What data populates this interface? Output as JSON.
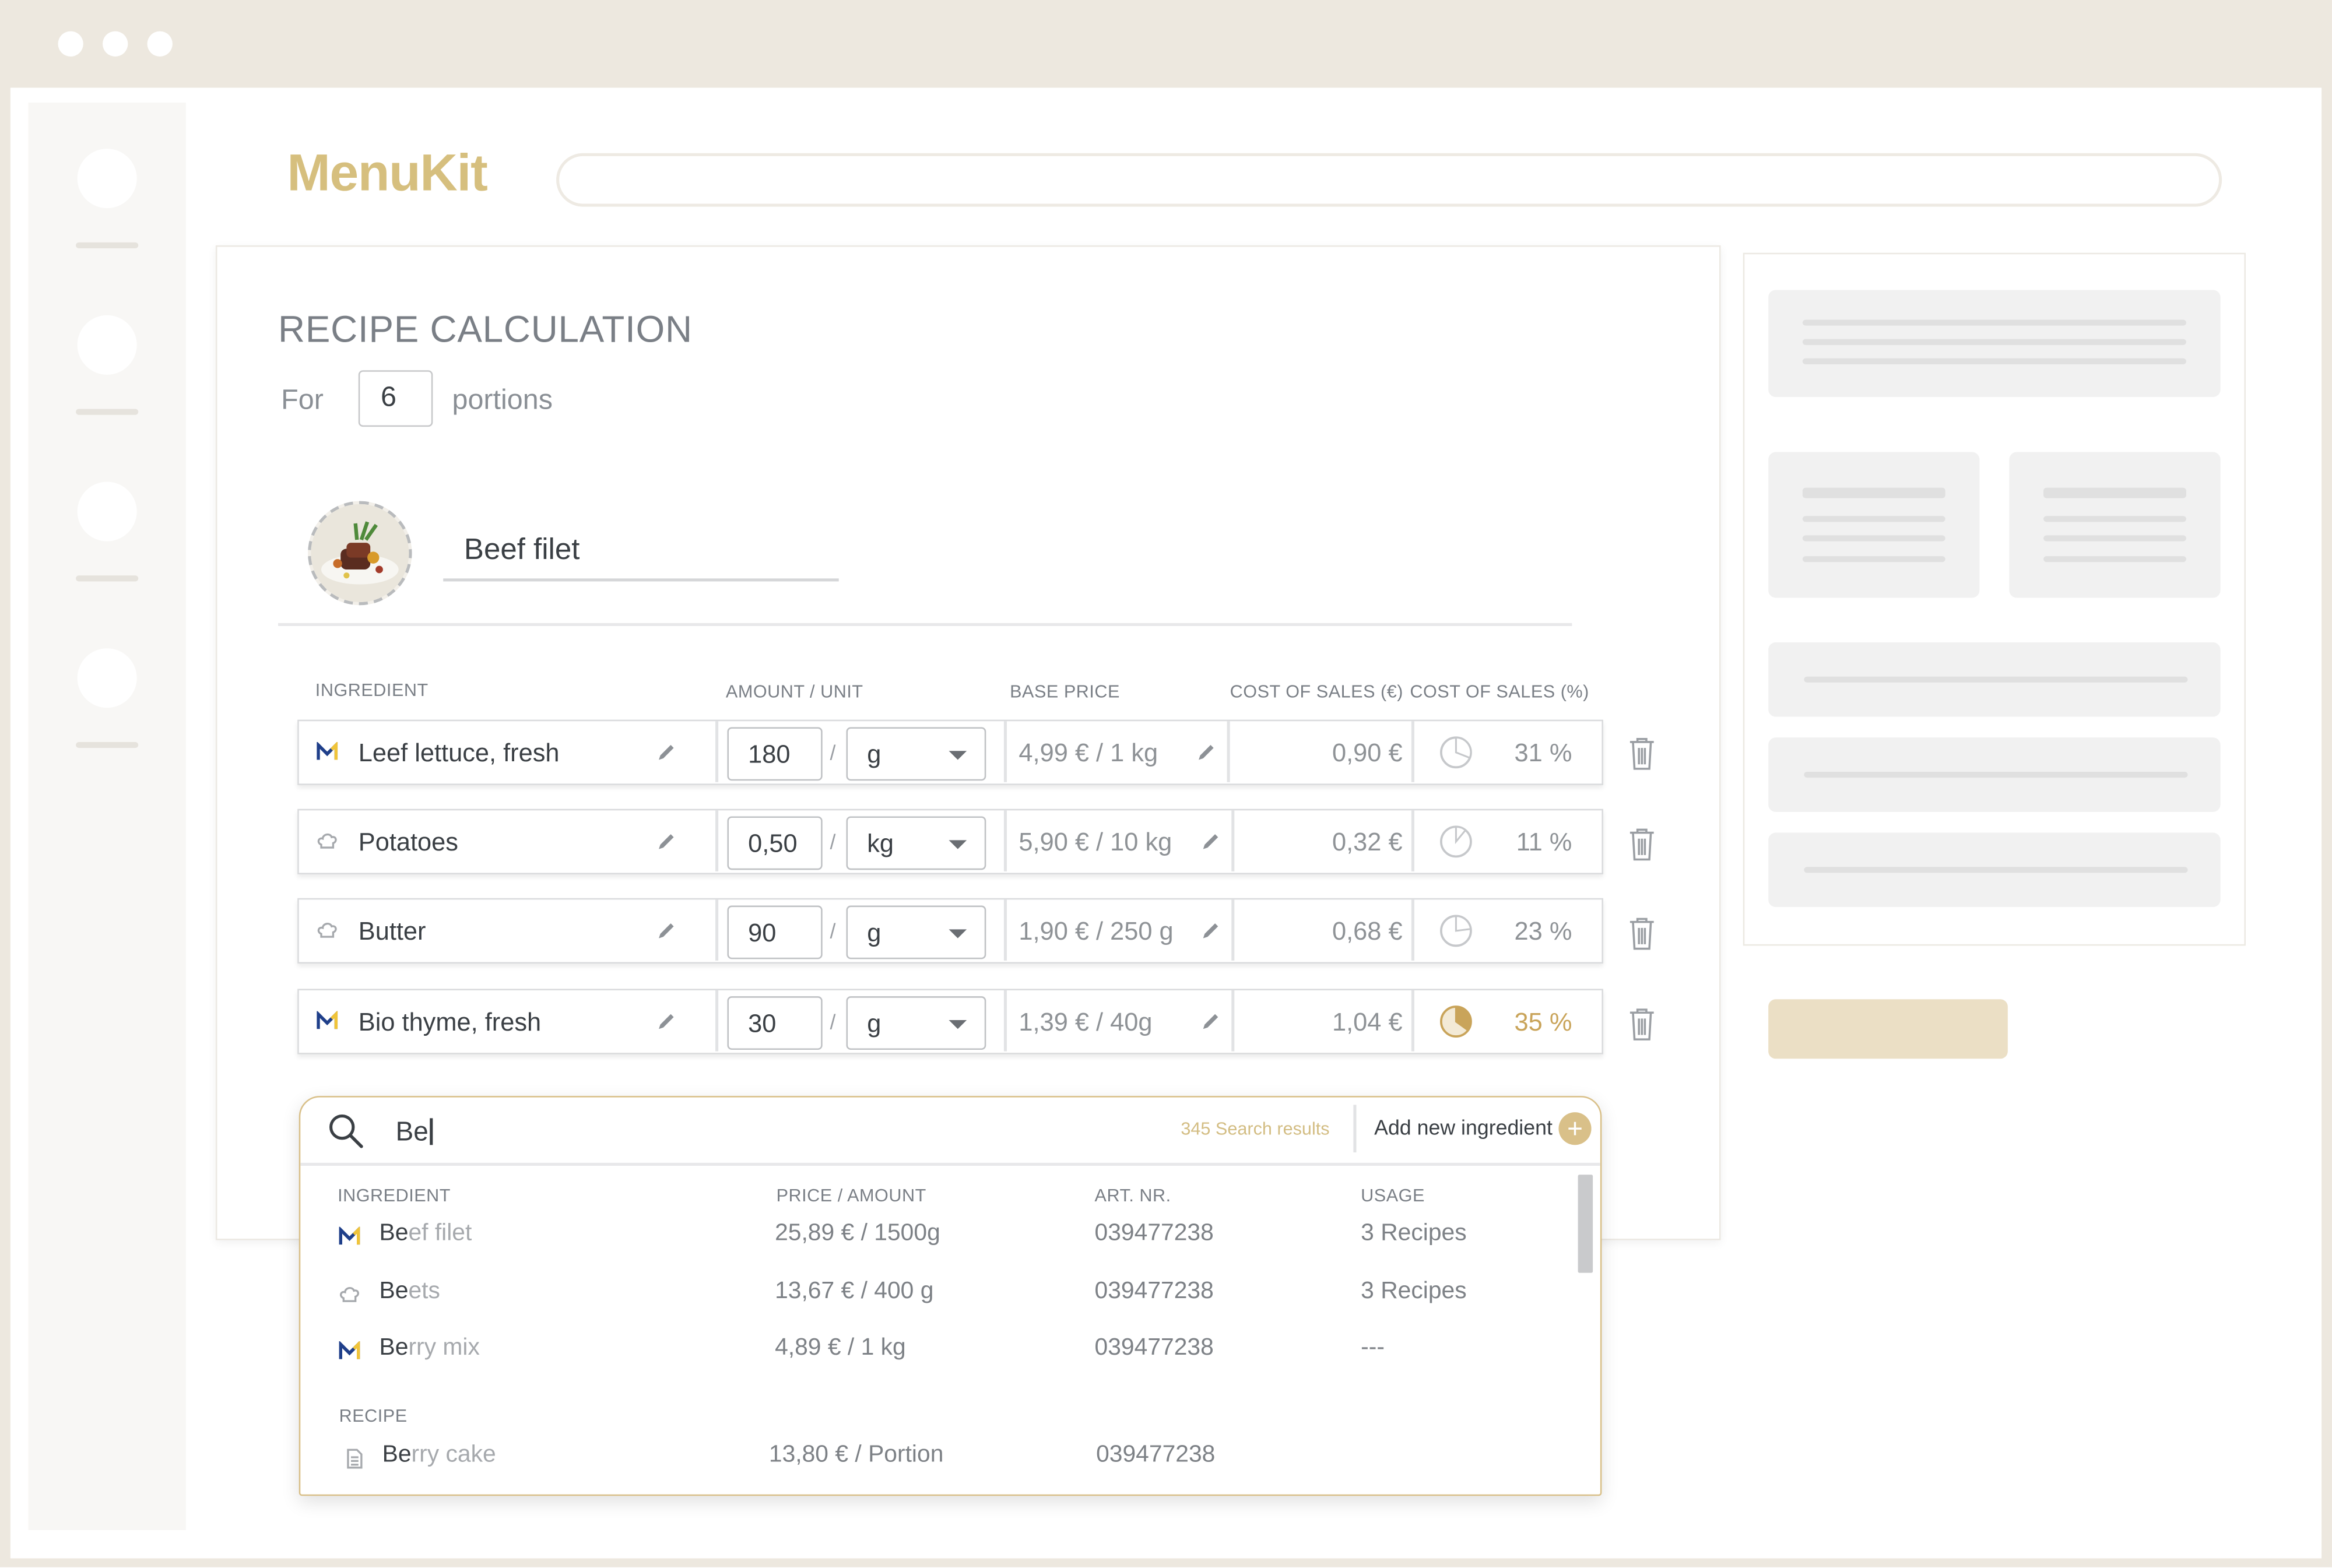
{
  "app": {
    "logo": "MenuKit"
  },
  "recipe": {
    "title": "RECIPE CALCULATION",
    "for_label": "For",
    "portions": "6",
    "portions_label": "portions",
    "name": "Beef filet"
  },
  "table": {
    "headers": {
      "ingredient": "INGREDIENT",
      "amount_unit": "AMOUNT /  UNIT",
      "base_price": "BASE PRICE",
      "cost_eur": "COST OF SALES (€)",
      "cost_pct": "COST OF SALES (%)"
    },
    "rows": [
      {
        "name": "Leef lettuce, fresh",
        "source": "metro-icon",
        "amount": "180",
        "unit": "g",
        "base_price": "4,99 € / 1 kg",
        "cost": "0,90 €",
        "pct": "31 %",
        "pct_value": 0.31,
        "warn": false
      },
      {
        "name": "Potatoes",
        "source": "chef-hat-icon",
        "amount": "0,50",
        "unit": "kg",
        "base_price": "5,90 € / 10 kg",
        "cost": "0,32 €",
        "pct": "11 %",
        "pct_value": 0.11,
        "warn": false
      },
      {
        "name": "Butter",
        "source": "chef-hat-icon",
        "amount": "90",
        "unit": "g",
        "base_price": "1,90 € / 250 g",
        "cost": "0,68 €",
        "pct": "23 %",
        "pct_value": 0.23,
        "warn": false
      },
      {
        "name": "Bio thyme, fresh",
        "source": "metro-icon",
        "amount": "30",
        "unit": "g",
        "base_price": "1,39 € / 40g",
        "cost": "1,04 €",
        "pct": "35 %",
        "pct_value": 0.35,
        "warn": true
      }
    ]
  },
  "search": {
    "query": "Be",
    "results_count": "345 Search results",
    "add_label": "Add new ingredient",
    "add_symbol": "+",
    "headers": {
      "ingredient": "INGREDIENT",
      "price": "PRICE / AMOUNT",
      "art": "ART. NR.",
      "usage": "USAGE"
    },
    "ingredients": [
      {
        "match": "Be",
        "rest": "ef filet",
        "source": "metro-icon",
        "price": "25,89 €  /  1500g",
        "art": "039477238",
        "usage": "3 Recipes"
      },
      {
        "match": "Be",
        "rest": "ets",
        "source": "chef-hat-icon",
        "price": "13,67 €  /  400 g",
        "art": "039477238",
        "usage": "3 Recipes"
      },
      {
        "match": "Be",
        "rest": "rry mix",
        "source": "metro-icon",
        "price": "4,89 €  /  1 kg",
        "art": "039477238",
        "usage": "---"
      }
    ],
    "recipe_header": "RECIPE",
    "recipes": [
      {
        "match": "Be",
        "rest": "rry cake",
        "source": "document-icon",
        "price": "13,80 €  /  Portion",
        "art": "039477238"
      }
    ]
  },
  "colors": {
    "accent": "#d6bf7e",
    "warn": "#c9a45a",
    "border_active": "#d9c089",
    "frame": "#ede8df"
  }
}
